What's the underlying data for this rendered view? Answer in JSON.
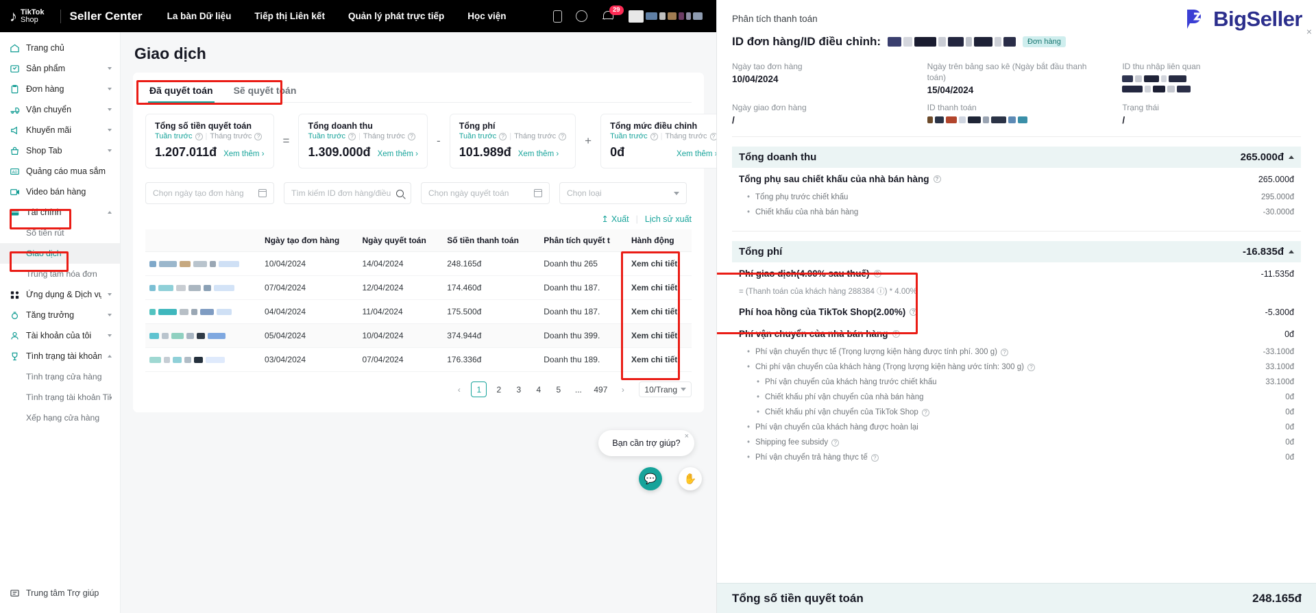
{
  "topbar": {
    "brand_name": "TikTok",
    "brand_sub": "Shop",
    "seller_center": "Seller Center",
    "nav": [
      "La bàn Dữ liệu",
      "Tiếp thị Liên kết",
      "Quản lý phát trực tiếp",
      "Học viện"
    ],
    "notification_count": "29"
  },
  "sidebar": {
    "items": [
      {
        "label": "Trang chủ",
        "icon": "home-icon",
        "expandable": false
      },
      {
        "label": "Sản phẩm",
        "icon": "product-icon",
        "expandable": true
      },
      {
        "label": "Đơn hàng",
        "icon": "order-icon",
        "expandable": true
      },
      {
        "label": "Vận chuyển",
        "icon": "shipping-icon",
        "expandable": true
      },
      {
        "label": "Khuyến mãi",
        "icon": "promotion-icon",
        "expandable": true
      },
      {
        "label": "Shop Tab",
        "icon": "shop-tab-icon",
        "expandable": true
      },
      {
        "label": "Quảng cáo mua sắm",
        "icon": "ads-icon",
        "expandable": false
      },
      {
        "label": "Video bán hàng",
        "icon": "video-icon",
        "expandable": false
      },
      {
        "label": "Tài chính",
        "icon": "finance-icon",
        "expandable": true,
        "highlighted": true
      },
      {
        "label": "Số tiền rút",
        "sub": true
      },
      {
        "label": "Giao dịch",
        "sub": true,
        "active": true,
        "highlighted": true
      },
      {
        "label": "Trung tâm hóa đơn",
        "sub": true
      },
      {
        "label": "Ứng dụng & Dịch vụ",
        "icon": "apps-icon",
        "expandable": true
      },
      {
        "label": "Tăng trưởng",
        "icon": "growth-icon",
        "expandable": true
      },
      {
        "label": "Tài khoản của tôi",
        "icon": "account-icon",
        "expandable": true
      },
      {
        "label": "Tình trạng tài khoản",
        "icon": "health-icon",
        "expandable": true
      },
      {
        "label": "Tình trạng cửa hàng",
        "sub": true
      },
      {
        "label": "Tình trạng tài khoản Tik...",
        "sub": true
      },
      {
        "label": "Xếp hạng cửa hàng",
        "sub": true
      }
    ],
    "help_center": "Trung tâm Trợ giúp"
  },
  "main": {
    "page_title": "Giao dịch",
    "tabs": [
      {
        "label": "Đã quyết toán",
        "active": true
      },
      {
        "label": "Sẽ quyết toán",
        "active": false
      }
    ],
    "stats": [
      {
        "title": "Tổng số tiền quyết toán",
        "sub_week": "Tuần trước",
        "sub_month": "Tháng trước",
        "value": "1.207.011đ",
        "more": "Xem thêm",
        "op_after": "="
      },
      {
        "title": "Tổng doanh thu",
        "sub_week": "Tuần trước",
        "sub_month": "Tháng trước",
        "value": "1.309.000đ",
        "more": "Xem thêm",
        "op_after": "-"
      },
      {
        "title": "Tổng phí",
        "sub_week": "Tuần trước",
        "sub_month": "Tháng trước",
        "value": "101.989đ",
        "more": "Xem thêm",
        "op_after": "+"
      },
      {
        "title": "Tổng mức điều chỉnh",
        "sub_week": "Tuần trước",
        "sub_month": "Tháng trước",
        "value": "0đ",
        "more": "Xem thêm",
        "op_after": ""
      }
    ],
    "filters": [
      {
        "placeholder": "Chọn ngày tạo đơn hàng",
        "icon": "calendar-icon"
      },
      {
        "placeholder": "Tìm kiếm ID đơn hàng/điều c...",
        "icon": "search-icon"
      },
      {
        "placeholder": "Chọn ngày quyết toán",
        "icon": "calendar-icon"
      },
      {
        "placeholder": "Chọn loại",
        "icon": "chevron-down-icon"
      }
    ],
    "export": {
      "export_label": "Xuất",
      "history_label": "Lịch sử xuất"
    },
    "table": {
      "columns": [
        "",
        "Ngày tạo đơn hàng",
        "Ngày quyết toán",
        "Số tiền thanh toán",
        "Phân tích quyết t",
        "Hành động"
      ],
      "rows": [
        {
          "order_date": "10/04/2024",
          "settle_date": "14/04/2024",
          "amount": "248.165đ",
          "analysis": "Doanh thu 265",
          "action": "Xem chi tiết"
        },
        {
          "order_date": "07/04/2024",
          "settle_date": "12/04/2024",
          "amount": "174.460đ",
          "analysis": "Doanh thu 187.",
          "action": "Xem chi tiết"
        },
        {
          "order_date": "04/04/2024",
          "settle_date": "11/04/2024",
          "amount": "175.500đ",
          "analysis": "Doanh thu 187.",
          "action": "Xem chi tiết"
        },
        {
          "order_date": "05/04/2024",
          "settle_date": "10/04/2024",
          "amount": "374.944đ",
          "analysis": "Doanh thu 399.",
          "action": "Xem chi tiết"
        },
        {
          "order_date": "03/04/2024",
          "settle_date": "07/04/2024",
          "amount": "176.336đ",
          "analysis": "Doanh thu 189.",
          "action": "Xem chi tiết"
        }
      ]
    },
    "pagination": {
      "prev": "‹",
      "next": "›",
      "pages": [
        "1",
        "2",
        "3",
        "4",
        "5",
        "...",
        "497"
      ],
      "current": "1",
      "per_page": "10/Trang"
    },
    "chat": {
      "text": "Bạn cần trợ giúp?",
      "close": "×"
    }
  },
  "right": {
    "brand": "BigSeller",
    "close": "×",
    "subtitle": "Phân tích thanh toán",
    "order_id_label": "ID đơn hàng/ID điều chỉnh:",
    "order_badge": "Đơn hàng",
    "meta": [
      {
        "label": "Ngày tạo đơn hàng",
        "value": "10/04/2024"
      },
      {
        "label": "Ngày trên bảng sao kê (Ngày bắt đầu thanh toán)",
        "value": "15/04/2024"
      },
      {
        "label": "ID thu nhập liên quan",
        "value": ""
      },
      {
        "label": "Ngày giao đơn hàng",
        "value": "/"
      },
      {
        "label": "ID thanh toán",
        "value": ""
      },
      {
        "label": "Trạng thái",
        "value": "/"
      }
    ],
    "sections": [
      {
        "title": "Tổng doanh thu",
        "value": "265.000đ",
        "rows": [
          {
            "level": 1,
            "label": "Tổng phụ sau chiết khấu của nhà bán hàng",
            "help": true,
            "value": "265.000đ"
          },
          {
            "level": 2,
            "label": "Tổng phụ trước chiết khấu",
            "value": "295.000đ"
          },
          {
            "level": 2,
            "label": "Chiết khấu của nhà bán hàng",
            "value": "-30.000đ"
          }
        ]
      },
      {
        "title": "Tổng phí",
        "value": "-16.835đ",
        "rows": [
          {
            "level": 1,
            "label": "Phí giao dịch(4.00% sau thuế)",
            "help": true,
            "value": "-11.535đ",
            "highlighted": true
          },
          {
            "level": 0,
            "label": "= (Thanh toán của khách hàng 288384 ⓘ) * 4.00%",
            "formula": true
          },
          {
            "level": 1,
            "label": "Phí hoa hồng của TikTok Shop(2.00%)",
            "help": true,
            "value": "-5.300đ",
            "highlighted": true
          },
          {
            "level": 1,
            "label": "Phí vận chuyển của nhà bán hàng",
            "help": true,
            "value": "0đ",
            "highlighted": true
          },
          {
            "level": 2,
            "label": "Phí vận chuyển thực tế (Trọng lượng kiện hàng được tính phí. 300 g)",
            "help": true,
            "value": "-33.100đ"
          },
          {
            "level": 2,
            "label": "Chi phí vận chuyển của khách hàng (Trọng lượng kiện hàng ước tính: 300 g)",
            "help": true,
            "value": "33.100đ"
          },
          {
            "level": 3,
            "label": "Phí vận chuyển của khách hàng trước chiết khấu",
            "value": "33.100đ"
          },
          {
            "level": 3,
            "label": "Chiết khấu phí vận chuyển của nhà bán hàng",
            "value": "0đ"
          },
          {
            "level": 3,
            "label": "Chiết khấu phí vận chuyển của TikTok Shop",
            "help": true,
            "value": "0đ"
          },
          {
            "level": 2,
            "label": "Phí vận chuyển của khách hàng được hoàn lại",
            "value": "0đ"
          },
          {
            "level": 2,
            "label": "Shipping fee subsidy",
            "help": true,
            "value": "0đ"
          },
          {
            "level": 2,
            "label": "Phí vận chuyển trả hàng thực tế",
            "help": true,
            "value": "0đ"
          }
        ]
      }
    ],
    "total": {
      "label": "Tổng số tiền quyết toán",
      "value": "248.165đ"
    }
  },
  "colors": {
    "accent_teal": "#16a39a",
    "annotation_red": "#ea1c15",
    "bigseller_blue": "#2b2e8c",
    "tiktok_pink": "#fe2c55"
  }
}
